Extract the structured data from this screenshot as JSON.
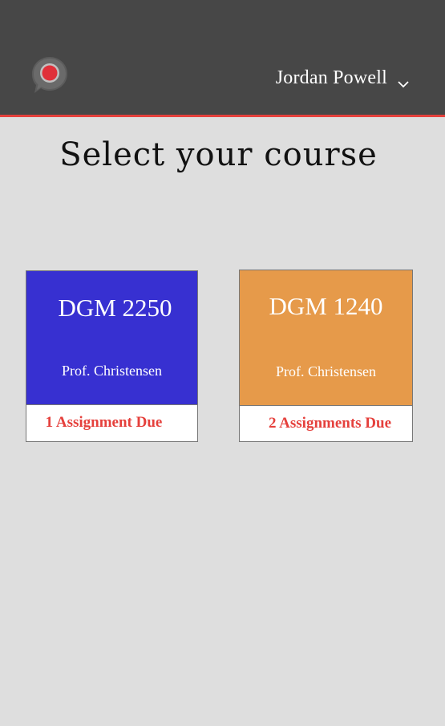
{
  "header": {
    "user_name": "Jordan Powell",
    "logo_icon": "chat-bubble-logo",
    "menu_icon": "chevron-down-icon",
    "background_color": "#474747",
    "accent_color": "#e5403c"
  },
  "main": {
    "title": "Select your course"
  },
  "courses": [
    {
      "code": "DGM 2250",
      "professor": "Prof. Christensen",
      "due": "1 Assignment Due",
      "color": "#3730d1"
    },
    {
      "code": "DGM 1240",
      "professor": "Prof. Christensen",
      "due": "2 Assignments Due",
      "color": "#e69a4a"
    }
  ]
}
